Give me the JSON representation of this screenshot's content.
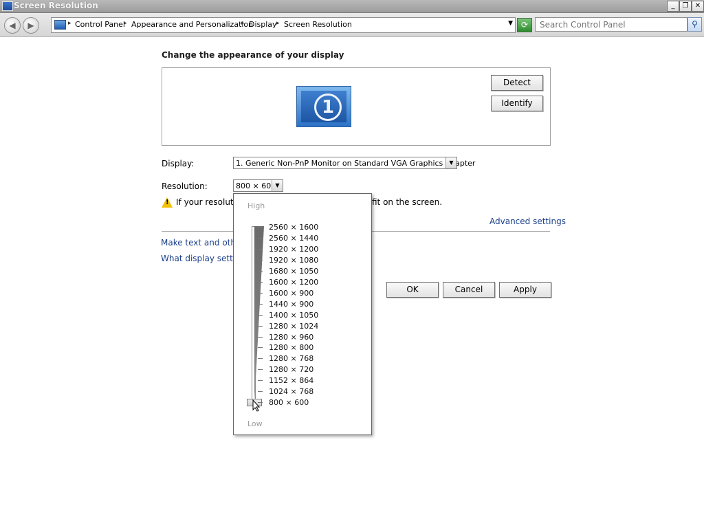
{
  "window": {
    "title": "Screen Resolution",
    "minimize_glyph": "_",
    "restore_glyph": "❐",
    "close_glyph": "✕"
  },
  "nav": {
    "back_glyph": "◀",
    "forward_glyph": "▶",
    "breadcrumbs": [
      "Control Panel",
      "Appearance and Personalization",
      "Display",
      "Screen Resolution"
    ],
    "search_placeholder": "Search Control Panel",
    "search_icon": "search-icon",
    "refresh_icon": "refresh-icon"
  },
  "content": {
    "heading": "Change the appearance of your display",
    "monitor_number": "1",
    "detect_label": "Detect",
    "identify_label": "Identify",
    "display_label": "Display:",
    "display_value": "1. Generic Non-PnP Monitor on Standard VGA Graphics Adapter",
    "resolution_label": "Resolution:",
    "resolution_value": "800 × 600",
    "warning_text_start": "If your resolution",
    "warning_text_end": "fit on the screen.",
    "advanced_link": "Advanced settings",
    "link_make_text": "Make text and other i",
    "link_display_settings": "What display settings",
    "ok_label": "OK",
    "cancel_label": "Cancel",
    "apply_label": "Apply"
  },
  "resolution_popup": {
    "high_label": "High",
    "low_label": "Low",
    "options": [
      "2560 × 1600",
      "2560 × 1440",
      "1920 × 1200",
      "1920 × 1080",
      "1680 × 1050",
      "1600 × 1200",
      "1600 × 900",
      "1440 × 900",
      "1400 × 1050",
      "1280 × 1024",
      "1280 × 960",
      "1280 × 800",
      "1280 × 768",
      "1280 × 720",
      "1152 × 864",
      "1024 × 768",
      "800 × 600"
    ],
    "selected": "800 × 600"
  }
}
